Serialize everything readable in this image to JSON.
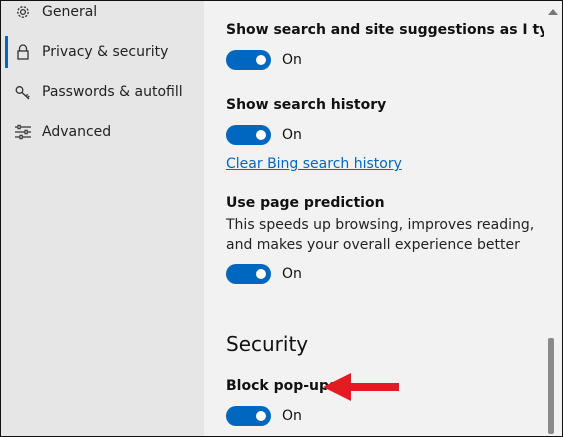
{
  "sidebar": {
    "items": [
      {
        "label": "General",
        "icon": "gear-icon"
      },
      {
        "label": "Privacy & security",
        "icon": "lock-icon",
        "active": true
      },
      {
        "label": "Passwords & autofill",
        "icon": "key-icon"
      },
      {
        "label": "Advanced",
        "icon": "sliders-icon"
      }
    ],
    "accent_color": "#0067c0"
  },
  "settings": {
    "search_suggestions": {
      "title": "Show search and site suggestions as I type",
      "state": "On"
    },
    "search_history": {
      "title": "Show search history",
      "state": "On",
      "link": "Clear Bing search history"
    },
    "page_prediction": {
      "title": "Use page prediction",
      "description": "This speeds up browsing, improves reading, and makes your overall experience better",
      "state": "On"
    },
    "security": {
      "heading": "Security",
      "block_popups": {
        "title": "Block pop-ups",
        "state": "On"
      }
    }
  },
  "colors": {
    "toggle_on": "#0067c0",
    "link": "#0067c0",
    "annotation_arrow": "#e31b23"
  }
}
